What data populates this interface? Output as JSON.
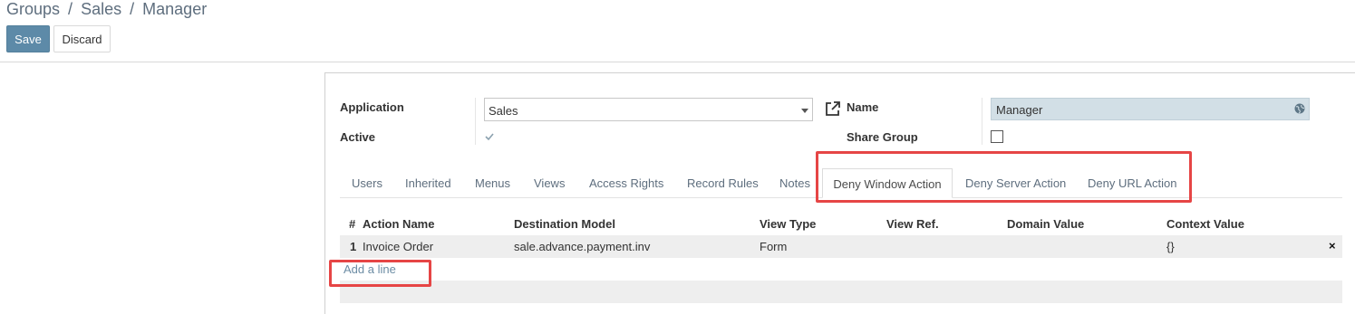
{
  "breadcrumb": {
    "items": [
      "Groups",
      "/",
      "Sales",
      "/",
      "Manager"
    ]
  },
  "toolbar": {
    "save_label": "Save",
    "discard_label": "Discard"
  },
  "form": {
    "application_label": "Application",
    "application_value": "Sales",
    "active_label": "Active",
    "name_label": "Name",
    "name_value": "Manager",
    "share_group_label": "Share Group"
  },
  "tabs": [
    {
      "label": "Users"
    },
    {
      "label": "Inherited"
    },
    {
      "label": "Menus"
    },
    {
      "label": "Views"
    },
    {
      "label": "Access Rights"
    },
    {
      "label": "Record Rules"
    },
    {
      "label": "Notes"
    },
    {
      "label": "Deny Window Action",
      "active": true
    },
    {
      "label": "Deny Server Action"
    },
    {
      "label": "Deny URL Action"
    }
  ],
  "table": {
    "columns": [
      "#",
      "Action Name",
      "Destination Model",
      "View Type",
      "View Ref.",
      "Domain Value",
      "Context Value"
    ],
    "rows": [
      {
        "num": "1",
        "action_name": "Invoice Order",
        "destination_model": "sale.advance.payment.inv",
        "view_type": "Form",
        "view_ref": "",
        "domain_value": "",
        "context_value": "{}"
      }
    ],
    "delete_icon": "×",
    "add_line_label": "Add a line"
  },
  "icons": {
    "external_link": "external-link-icon",
    "globe": "globe-icon",
    "check": "check-icon",
    "delete": "close-icon"
  },
  "colors": {
    "primary": "#5d8aa8",
    "highlight": "#e64545",
    "readonly_field": "#d2dfe6",
    "link": "#6c8ca4"
  }
}
